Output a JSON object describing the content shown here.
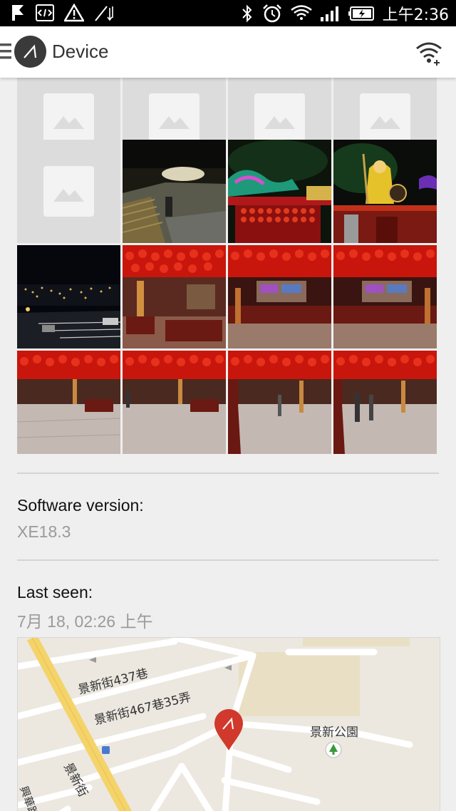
{
  "status_bar": {
    "time": "上午2:36",
    "icons": [
      "notification-flag-icon",
      "code-icon",
      "warning-icon",
      "signal-arrows-icon",
      "bluetooth-icon",
      "alarm-icon",
      "wifi-icon",
      "cellular-signal-icon",
      "battery-charging-icon"
    ]
  },
  "app_bar": {
    "title": "Device",
    "left_icon": "menu-icon",
    "logo_icon": "glass-logo-icon",
    "action_icon": "wifi-add-icon"
  },
  "photo_grid": {
    "cells": [
      {
        "kind": "placeholder"
      },
      {
        "kind": "placeholder"
      },
      {
        "kind": "placeholder"
      },
      {
        "kind": "placeholder"
      },
      {
        "kind": "placeholder"
      },
      {
        "kind": "photo",
        "scene": "night-steps"
      },
      {
        "kind": "photo",
        "scene": "temple-dragon"
      },
      {
        "kind": "photo",
        "scene": "temple-statue"
      },
      {
        "kind": "photo",
        "scene": "night-city"
      },
      {
        "kind": "photo",
        "scene": "red-lanterns"
      },
      {
        "kind": "photo",
        "scene": "red-lanterns"
      },
      {
        "kind": "photo",
        "scene": "red-lanterns"
      },
      {
        "kind": "photo",
        "scene": "temple-hall"
      },
      {
        "kind": "photo",
        "scene": "temple-hall"
      },
      {
        "kind": "photo",
        "scene": "temple-hall"
      },
      {
        "kind": "photo",
        "scene": "temple-hall"
      }
    ]
  },
  "software": {
    "label": "Software version:",
    "value": "XE18.3"
  },
  "last_seen": {
    "label": "Last seen:",
    "value": "7月 18, 02:26 上午"
  },
  "map": {
    "labels": {
      "street1": "景新街437巷",
      "street2": "景新街467巷35弄",
      "park": "景新公園",
      "main_street": "景新街",
      "street3": "興華路"
    },
    "pin_icon": "location-pin-icon"
  },
  "colors": {
    "accent_red": "#d0392b",
    "map_road_yellow": "#f4d36a"
  }
}
